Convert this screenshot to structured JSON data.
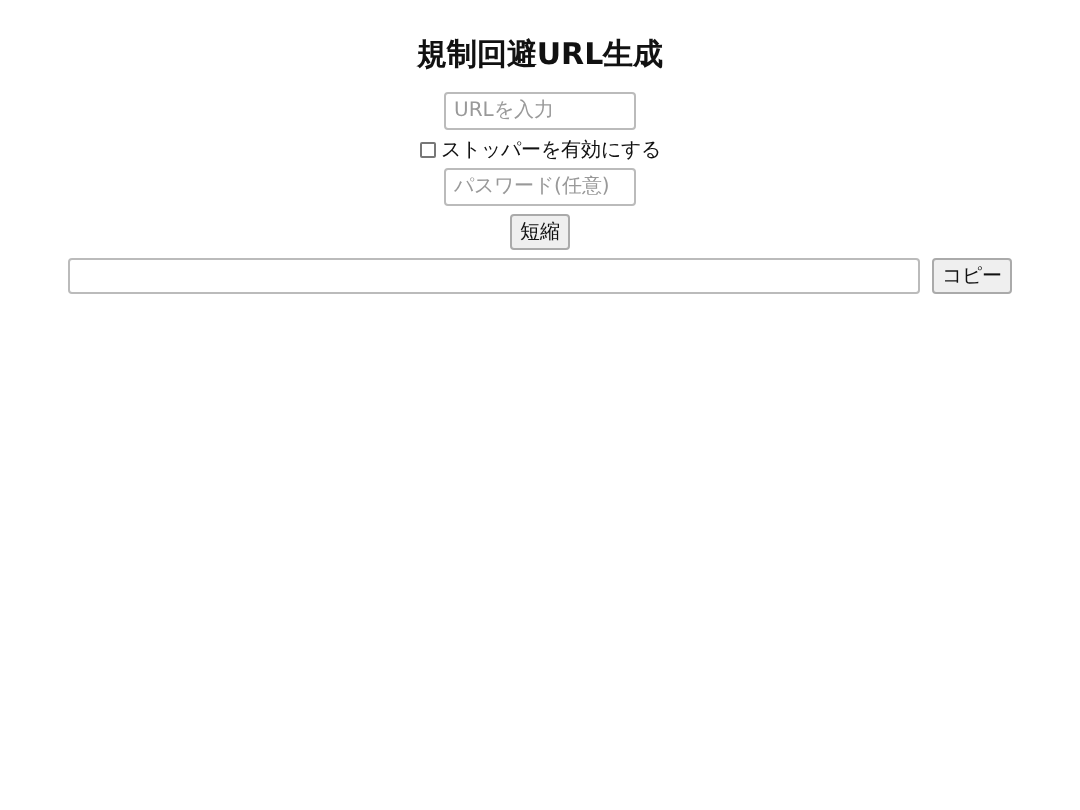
{
  "title": "規制回避URL生成",
  "url_field": {
    "placeholder": "URLを入力"
  },
  "stopper": {
    "label": "ストッパーを有効にする",
    "checked": false
  },
  "password_field": {
    "placeholder": "パスワード(任意)"
  },
  "shorten_button": "短縮",
  "copy_button": "コピー"
}
